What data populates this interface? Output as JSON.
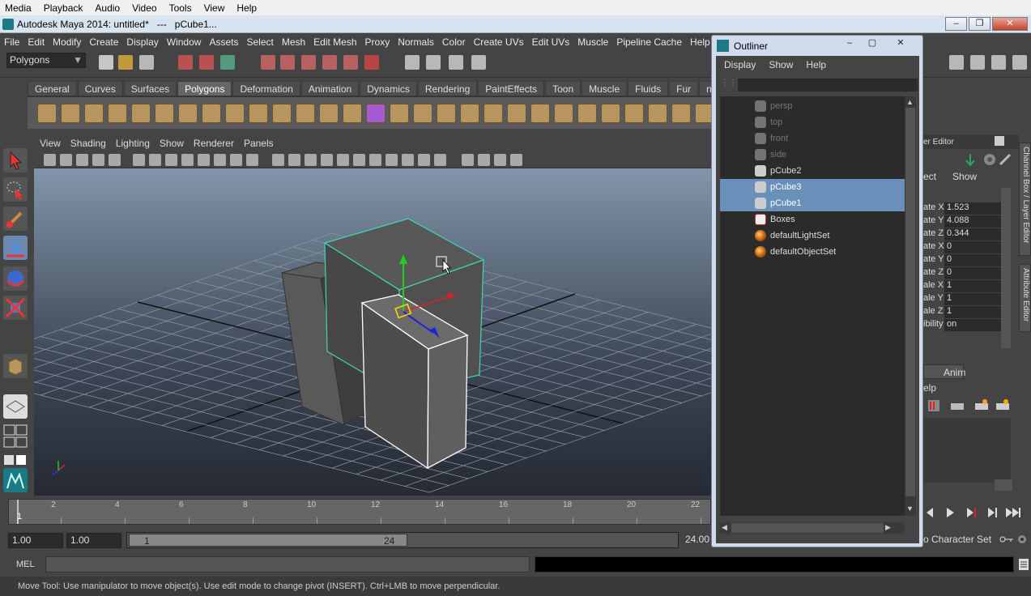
{
  "recorder_menu": [
    "Media",
    "Playback",
    "Audio",
    "Video",
    "Tools",
    "View",
    "Help"
  ],
  "window_title": "Autodesk Maya 2014: untitled*   ---   pCube1...",
  "main_menu": [
    "File",
    "Edit",
    "Modify",
    "Create",
    "Display",
    "Window",
    "Assets",
    "Select",
    "Mesh",
    "Edit Mesh",
    "Proxy",
    "Normals",
    "Color",
    "Create UVs",
    "Edit UVs",
    "Muscle",
    "Pipeline Cache",
    "Help"
  ],
  "mode_select": "Polygons",
  "shelf_tabs": [
    "General",
    "Curves",
    "Surfaces",
    "Polygons",
    "Deformation",
    "Animation",
    "Dynamics",
    "Rendering",
    "PaintEffects",
    "Toon",
    "Muscle",
    "Fluids",
    "Fur",
    "nH"
  ],
  "active_shelf_tab": "Polygons",
  "view_menu": [
    "View",
    "Shading",
    "Lighting",
    "Show",
    "Renderer",
    "Panels"
  ],
  "timeline": {
    "ticks": [
      "1",
      "2",
      "4",
      "6",
      "8",
      "10",
      "12",
      "14",
      "16",
      "18",
      "20",
      "22"
    ],
    "current": "1"
  },
  "range": {
    "start": "1.00",
    "playback_start": "1.00",
    "slider_start": "1",
    "slider_end": "24",
    "end": "24.00",
    "character_set": "o Character Set"
  },
  "command_line": {
    "label": "MEL"
  },
  "help_line": "Move Tool: Use manipulator to move object(s). Use edit mode to change pivot (INSERT).  Ctrl+LMB to move perpendicular.",
  "channel_box": {
    "header": "er Editor",
    "menu": [
      "ect",
      "Show"
    ],
    "rows": [
      {
        "label": "ate X",
        "value": "1.523"
      },
      {
        "label": "ate Y",
        "value": "4.088"
      },
      {
        "label": "ate Z",
        "value": "0.344"
      },
      {
        "label": "ate X",
        "value": "0"
      },
      {
        "label": "ate Y",
        "value": "0"
      },
      {
        "label": "ate Z",
        "value": "0"
      },
      {
        "label": "ale X",
        "value": "1"
      },
      {
        "label": "ale Y",
        "value": "1"
      },
      {
        "label": "ale Z",
        "value": "1"
      },
      {
        "label": "ibility",
        "value": "on"
      }
    ],
    "layer_tab": "Anim",
    "layer_help": "elp"
  },
  "side_tabs": [
    "Channel Box / Layer Editor",
    "Attribute Editor"
  ],
  "outliner": {
    "title": "Outliner",
    "menu": [
      "Display",
      "Show",
      "Help"
    ],
    "items": [
      {
        "name": "persp",
        "state": "dim"
      },
      {
        "name": "top",
        "state": "dim"
      },
      {
        "name": "front",
        "state": "dim"
      },
      {
        "name": "side",
        "state": "dim"
      },
      {
        "name": "pCube2",
        "state": "normal"
      },
      {
        "name": "pCube3",
        "state": "selected"
      },
      {
        "name": "pCube1",
        "state": "selected"
      },
      {
        "name": "Boxes",
        "state": "normal"
      },
      {
        "name": "defaultLightSet",
        "state": "normal"
      },
      {
        "name": "defaultObjectSet",
        "state": "normal"
      }
    ]
  },
  "colors": {
    "maya_bg": "#444444",
    "selection": "#6890b8",
    "accent_teal": "#1c7a86"
  }
}
